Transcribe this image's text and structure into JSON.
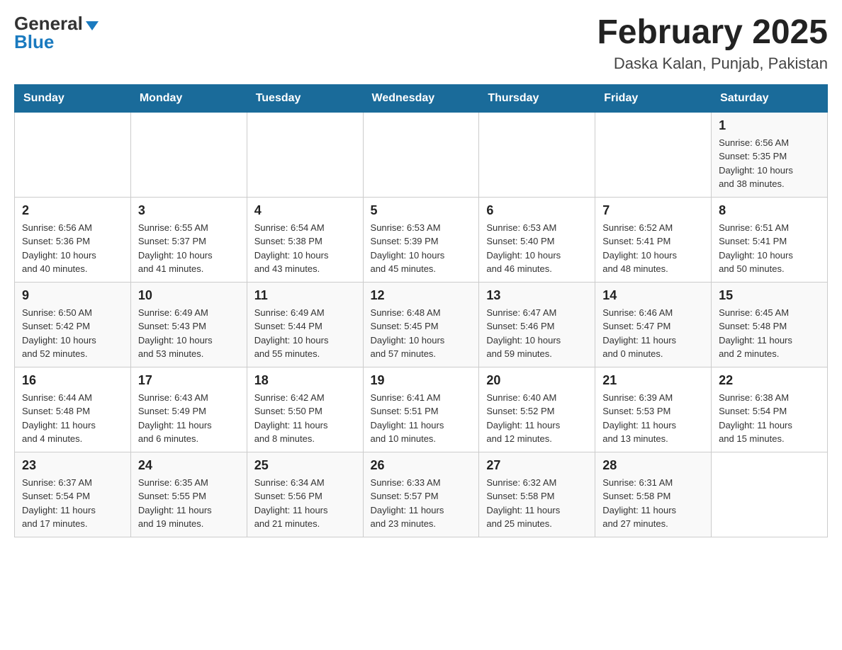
{
  "header": {
    "logo_general": "General",
    "logo_blue": "Blue",
    "month_title": "February 2025",
    "location": "Daska Kalan, Punjab, Pakistan"
  },
  "days_of_week": [
    "Sunday",
    "Monday",
    "Tuesday",
    "Wednesday",
    "Thursday",
    "Friday",
    "Saturday"
  ],
  "weeks": [
    {
      "row_class": "row-odd",
      "days": [
        {
          "number": "",
          "info": ""
        },
        {
          "number": "",
          "info": ""
        },
        {
          "number": "",
          "info": ""
        },
        {
          "number": "",
          "info": ""
        },
        {
          "number": "",
          "info": ""
        },
        {
          "number": "",
          "info": ""
        },
        {
          "number": "1",
          "info": "Sunrise: 6:56 AM\nSunset: 5:35 PM\nDaylight: 10 hours\nand 38 minutes."
        }
      ]
    },
    {
      "row_class": "row-even",
      "days": [
        {
          "number": "2",
          "info": "Sunrise: 6:56 AM\nSunset: 5:36 PM\nDaylight: 10 hours\nand 40 minutes."
        },
        {
          "number": "3",
          "info": "Sunrise: 6:55 AM\nSunset: 5:37 PM\nDaylight: 10 hours\nand 41 minutes."
        },
        {
          "number": "4",
          "info": "Sunrise: 6:54 AM\nSunset: 5:38 PM\nDaylight: 10 hours\nand 43 minutes."
        },
        {
          "number": "5",
          "info": "Sunrise: 6:53 AM\nSunset: 5:39 PM\nDaylight: 10 hours\nand 45 minutes."
        },
        {
          "number": "6",
          "info": "Sunrise: 6:53 AM\nSunset: 5:40 PM\nDaylight: 10 hours\nand 46 minutes."
        },
        {
          "number": "7",
          "info": "Sunrise: 6:52 AM\nSunset: 5:41 PM\nDaylight: 10 hours\nand 48 minutes."
        },
        {
          "number": "8",
          "info": "Sunrise: 6:51 AM\nSunset: 5:41 PM\nDaylight: 10 hours\nand 50 minutes."
        }
      ]
    },
    {
      "row_class": "row-odd",
      "days": [
        {
          "number": "9",
          "info": "Sunrise: 6:50 AM\nSunset: 5:42 PM\nDaylight: 10 hours\nand 52 minutes."
        },
        {
          "number": "10",
          "info": "Sunrise: 6:49 AM\nSunset: 5:43 PM\nDaylight: 10 hours\nand 53 minutes."
        },
        {
          "number": "11",
          "info": "Sunrise: 6:49 AM\nSunset: 5:44 PM\nDaylight: 10 hours\nand 55 minutes."
        },
        {
          "number": "12",
          "info": "Sunrise: 6:48 AM\nSunset: 5:45 PM\nDaylight: 10 hours\nand 57 minutes."
        },
        {
          "number": "13",
          "info": "Sunrise: 6:47 AM\nSunset: 5:46 PM\nDaylight: 10 hours\nand 59 minutes."
        },
        {
          "number": "14",
          "info": "Sunrise: 6:46 AM\nSunset: 5:47 PM\nDaylight: 11 hours\nand 0 minutes."
        },
        {
          "number": "15",
          "info": "Sunrise: 6:45 AM\nSunset: 5:48 PM\nDaylight: 11 hours\nand 2 minutes."
        }
      ]
    },
    {
      "row_class": "row-even",
      "days": [
        {
          "number": "16",
          "info": "Sunrise: 6:44 AM\nSunset: 5:48 PM\nDaylight: 11 hours\nand 4 minutes."
        },
        {
          "number": "17",
          "info": "Sunrise: 6:43 AM\nSunset: 5:49 PM\nDaylight: 11 hours\nand 6 minutes."
        },
        {
          "number": "18",
          "info": "Sunrise: 6:42 AM\nSunset: 5:50 PM\nDaylight: 11 hours\nand 8 minutes."
        },
        {
          "number": "19",
          "info": "Sunrise: 6:41 AM\nSunset: 5:51 PM\nDaylight: 11 hours\nand 10 minutes."
        },
        {
          "number": "20",
          "info": "Sunrise: 6:40 AM\nSunset: 5:52 PM\nDaylight: 11 hours\nand 12 minutes."
        },
        {
          "number": "21",
          "info": "Sunrise: 6:39 AM\nSunset: 5:53 PM\nDaylight: 11 hours\nand 13 minutes."
        },
        {
          "number": "22",
          "info": "Sunrise: 6:38 AM\nSunset: 5:54 PM\nDaylight: 11 hours\nand 15 minutes."
        }
      ]
    },
    {
      "row_class": "row-odd",
      "days": [
        {
          "number": "23",
          "info": "Sunrise: 6:37 AM\nSunset: 5:54 PM\nDaylight: 11 hours\nand 17 minutes."
        },
        {
          "number": "24",
          "info": "Sunrise: 6:35 AM\nSunset: 5:55 PM\nDaylight: 11 hours\nand 19 minutes."
        },
        {
          "number": "25",
          "info": "Sunrise: 6:34 AM\nSunset: 5:56 PM\nDaylight: 11 hours\nand 21 minutes."
        },
        {
          "number": "26",
          "info": "Sunrise: 6:33 AM\nSunset: 5:57 PM\nDaylight: 11 hours\nand 23 minutes."
        },
        {
          "number": "27",
          "info": "Sunrise: 6:32 AM\nSunset: 5:58 PM\nDaylight: 11 hours\nand 25 minutes."
        },
        {
          "number": "28",
          "info": "Sunrise: 6:31 AM\nSunset: 5:58 PM\nDaylight: 11 hours\nand 27 minutes."
        },
        {
          "number": "",
          "info": ""
        }
      ]
    }
  ]
}
